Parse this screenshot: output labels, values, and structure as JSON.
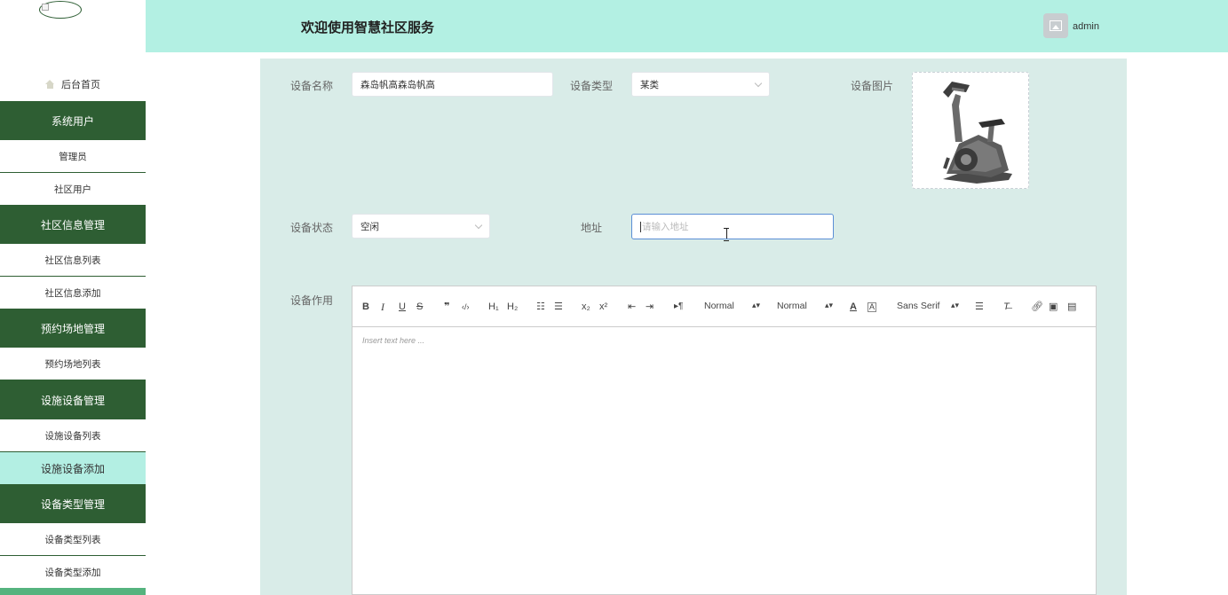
{
  "header": {
    "title": "欢迎使用智慧社区服务",
    "username": "admin"
  },
  "sidebar": {
    "home": "后台首页",
    "groups": [
      {
        "label": "系统用户",
        "items": [
          "管理员",
          "社区用户"
        ]
      },
      {
        "label": "社区信息管理",
        "items": [
          "社区信息列表",
          "社区信息添加"
        ]
      },
      {
        "label": "预约场地管理",
        "items": [
          "预约场地列表"
        ]
      },
      {
        "label": "设施设备管理",
        "items": [
          "设施设备列表",
          "设施设备添加"
        ]
      },
      {
        "label": "设备类型管理",
        "items": [
          "设备类型列表",
          "设备类型添加"
        ]
      }
    ],
    "active_item": "设施设备添加"
  },
  "form": {
    "name_label": "设备名称",
    "name_value": "森岛帆高森岛帆高",
    "type_label": "设备类型",
    "type_value": "某类",
    "image_label": "设备图片",
    "status_label": "设备状态",
    "status_value": "空闲",
    "address_label": "地址",
    "address_placeholder": "请输入地址",
    "function_label": "设备作用"
  },
  "editor": {
    "toolbar": {
      "bold": "B",
      "italic": "I",
      "underline": "U",
      "strike": "S",
      "blockquote": "❞",
      "code": "‹/›",
      "h1": "H₁",
      "h2": "H₂",
      "ordered_list": "☷",
      "bullet_list": "☰",
      "subscript": "x₂",
      "superscript": "x²",
      "outdent": "⇤",
      "indent": "⇥",
      "direction": "▸¶",
      "size_value": "Normal",
      "header_value": "Normal",
      "font_value": "Sans Serif"
    },
    "placeholder": "Insert text here ..."
  }
}
